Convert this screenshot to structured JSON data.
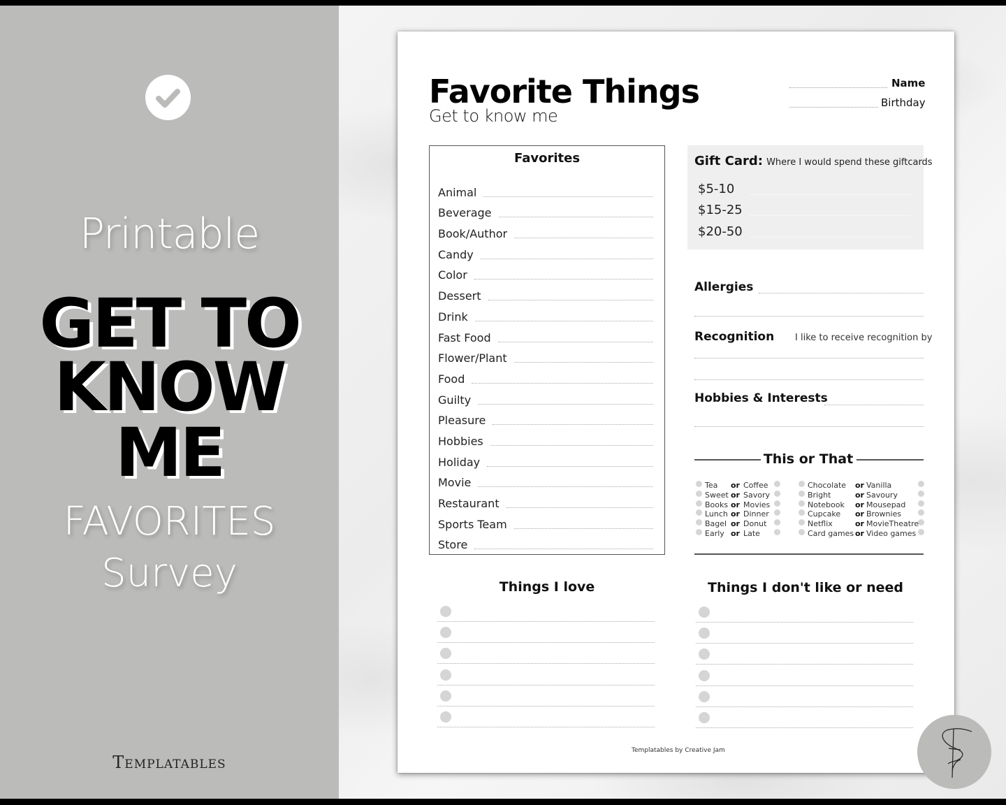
{
  "promo": {
    "badge_icon": "check-circle-icon",
    "printable": "Printable",
    "headline": [
      "GET TO",
      "KNOW",
      "ME"
    ],
    "favorites": "FAVORITES",
    "survey": "Survey",
    "brand": "Templatables"
  },
  "sheet": {
    "title": "Favorite Things",
    "subtitle": "Get to know me",
    "name_label": "Name",
    "birthday_label": "Birthday",
    "favorites": {
      "title": "Favorites",
      "items": [
        "Animal",
        "Beverage",
        "Book/Author",
        "Candy",
        "Color",
        "Dessert",
        "Drink",
        "Fast Food",
        "Flower/Plant",
        "Food",
        "Guilty",
        "Pleasure",
        "Hobbies",
        "Holiday",
        "Movie",
        "Restaurant",
        "Sports Team",
        "Store"
      ]
    },
    "gift_card": {
      "label": "Gift Card:",
      "note": "Where I would spend these giftcards",
      "ranges": [
        "$5-10",
        "$15-25",
        "$20-50"
      ]
    },
    "allergies_label": "Allergies",
    "recognition_label": "Recognition",
    "recognition_note": "I like to receive recognition by",
    "hobbies_label": "Hobbies & Interests",
    "this_or_that": {
      "title": "This or That",
      "or_label": "or",
      "left_pairs": [
        [
          "Tea",
          "Coffee"
        ],
        [
          "Sweet",
          "Savory"
        ],
        [
          "Books",
          "Movies"
        ],
        [
          "Lunch",
          "Dinner"
        ],
        [
          "Bagel",
          "Donut"
        ],
        [
          "Early",
          "Late"
        ]
      ],
      "right_pairs": [
        [
          "Chocolate",
          "Vanilla"
        ],
        [
          "Bright",
          "Savoury"
        ],
        [
          "Notebook",
          "Mousepad"
        ],
        [
          "Cupcake",
          "Brownies"
        ],
        [
          "Netflix",
          "MovieTheatre"
        ],
        [
          "Card games",
          "Video games"
        ]
      ]
    },
    "things_love_title": "Things I love",
    "things_dislike_title": "Things I don't like or need",
    "list_rows": 6,
    "footer": "Templatables by Creative Jam"
  },
  "colors": {
    "promo_bg": "#bbbbba",
    "paper": "#ffffff",
    "gift_bg": "#efefef",
    "bullet": "#d5d5d5",
    "text": "#111111"
  }
}
